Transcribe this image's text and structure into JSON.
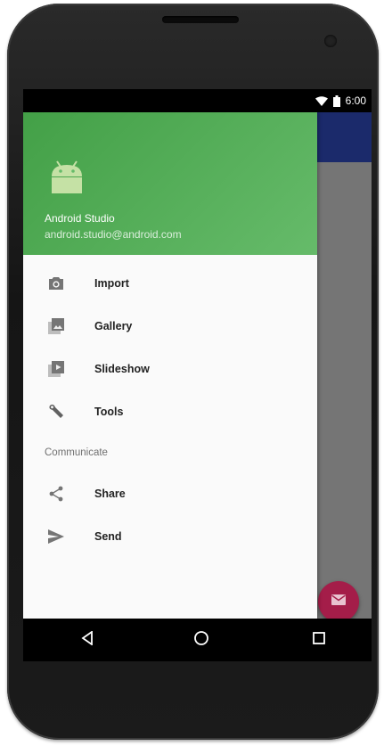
{
  "status": {
    "time": "6:00"
  },
  "drawer": {
    "header": {
      "name": "Android Studio",
      "email": "android.studio@android.com"
    },
    "items": [
      {
        "label": "Import",
        "icon": "camera-icon"
      },
      {
        "label": "Gallery",
        "icon": "gallery-icon"
      },
      {
        "label": "Slideshow",
        "icon": "slideshow-icon"
      },
      {
        "label": "Tools",
        "icon": "wrench-icon"
      }
    ],
    "section_title": "Communicate",
    "section_items": [
      {
        "label": "Share",
        "icon": "share-icon"
      },
      {
        "label": "Send",
        "icon": "send-icon"
      }
    ]
  },
  "colors": {
    "header_green": "#4caf50",
    "toolbar_blue": "#1b2a6b",
    "fab_color": "#a41d49"
  }
}
